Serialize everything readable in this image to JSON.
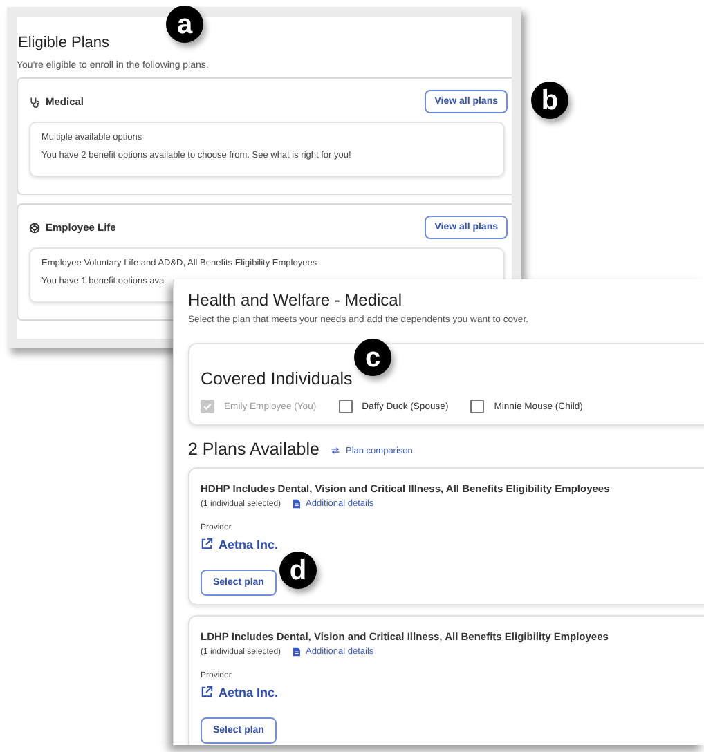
{
  "eligible_plans": {
    "title": "Eligible Plans",
    "subtitle": "You're eligible to enroll in the following plans.",
    "categories": [
      {
        "kind": "medical",
        "name": "Medical",
        "button": "View all plans",
        "lines": [
          "Multiple available options",
          "You have 2 benefit options available to choose from. See what is right for you!"
        ]
      },
      {
        "kind": "life",
        "name": "Employee Life",
        "button": "View all plans",
        "lines": [
          "Employee Voluntary Life and AD&D, All Benefits Eligibility Employees",
          "You have 1 benefit options ava"
        ]
      }
    ]
  },
  "medical": {
    "title": "Health and Welfare - Medical",
    "subtitle": "Select the plan that meets your needs and add the dependents you want to cover.",
    "covered": {
      "title": "Covered Individuals",
      "people": [
        {
          "label": "Emily Employee (You)",
          "checked": true,
          "disabled": true
        },
        {
          "label": "Daffy Duck (Spouse)",
          "checked": false,
          "disabled": false
        },
        {
          "label": "Minnie Mouse (Child)",
          "checked": false,
          "disabled": false
        }
      ]
    },
    "plans_heading": "2 Plans Available",
    "comparison_link": "Plan comparison",
    "plans": [
      {
        "name": "HDHP Includes Dental, Vision and Critical Illness, All Benefits Eligibility Employees",
        "selection": "(1 individual selected)",
        "details_link": "Additional details",
        "provider_label": "Provider",
        "provider": "Aetna Inc.",
        "button": "Select plan"
      },
      {
        "name": "LDHP Includes Dental, Vision and Critical Illness, All Benefits Eligibility Employees",
        "selection": "(1 individual selected)",
        "details_link": "Additional details",
        "provider_label": "Provider",
        "provider": "Aetna Inc.",
        "button": "Select plan"
      }
    ]
  },
  "callouts": [
    "a",
    "b",
    "c",
    "d"
  ]
}
